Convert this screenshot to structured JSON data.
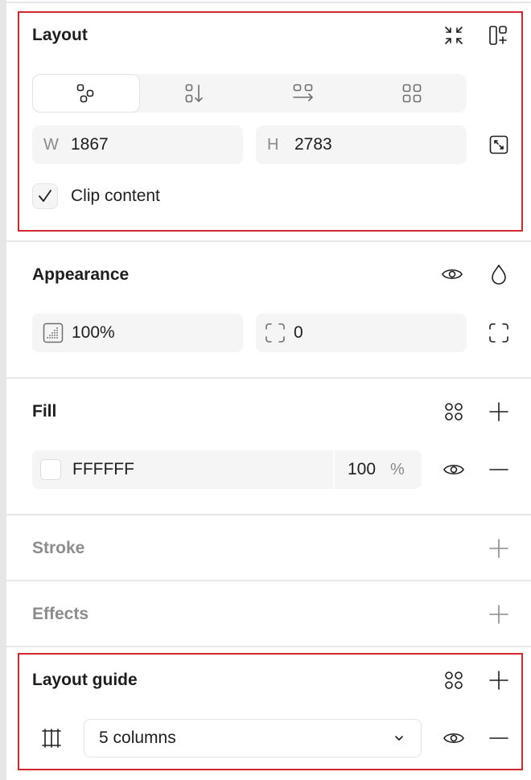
{
  "layout": {
    "title": "Layout",
    "width_prefix": "W",
    "width_value": "1867",
    "height_prefix": "H",
    "height_value": "2783",
    "clip_label": "Clip content",
    "clip_checked": true,
    "flow_options": [
      "freeform-layout-icon",
      "vertical-auto-layout-icon",
      "horizontal-auto-layout-icon",
      "grid-layout-icon"
    ],
    "selected_flow": "freeform"
  },
  "appearance": {
    "title": "Appearance",
    "opacity_value": "100%",
    "corner_radius_value": "0"
  },
  "fill": {
    "title": "Fill",
    "color_hex": "FFFFFF",
    "swatch_color": "#FFFFFF",
    "opacity_value": "100",
    "opacity_unit": "%"
  },
  "stroke": {
    "title": "Stroke"
  },
  "effects": {
    "title": "Effects"
  },
  "layout_guide": {
    "title": "Layout guide",
    "selected_option": "5 columns"
  },
  "colors": {
    "highlight_border": "#d0282e",
    "field_bg": "#f5f5f5",
    "dim_text": "#8c8c8c"
  }
}
